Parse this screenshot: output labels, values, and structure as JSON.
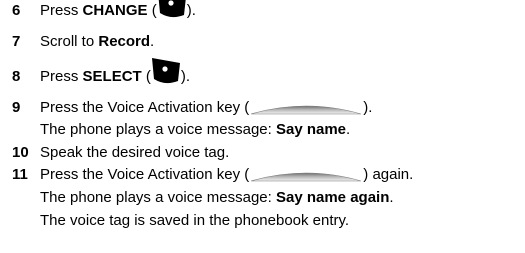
{
  "steps": [
    {
      "number": "6",
      "pre": "Press ",
      "bold": "CHANGE",
      "open": " (",
      "icon": "left-softkey-icon",
      "close": ")."
    },
    {
      "number": "7",
      "pre": "Scroll to ",
      "bold": "Record",
      "post": "."
    },
    {
      "number": "8",
      "pre": "Press ",
      "bold": "SELECT",
      "open": " (",
      "icon": "left-softkey-icon",
      "close": ")."
    },
    {
      "number": "9",
      "pre": "Press the Voice Activation key (",
      "icon": "voice-activation-key-icon",
      "close": ")."
    },
    {
      "number": "10",
      "text": "Speak the desired voice tag."
    },
    {
      "number": "11",
      "pre": "Press the Voice Activation key (",
      "icon": "voice-activation-key-icon",
      "close": ") again."
    }
  ],
  "step9_result": {
    "pre": "The phone plays a voice message: ",
    "bold": "Say name",
    "post": "."
  },
  "step11_result": {
    "pre": "The phone plays a voice message: ",
    "bold": "Say name again",
    "post": "."
  },
  "step11_note": "The voice tag is saved in the phonebook entry.",
  "colors": {
    "text": "#000000",
    "key_fill": "#000000",
    "voice_key_dark": "#8a8a8a",
    "voice_key_light": "#f0f0f0"
  }
}
